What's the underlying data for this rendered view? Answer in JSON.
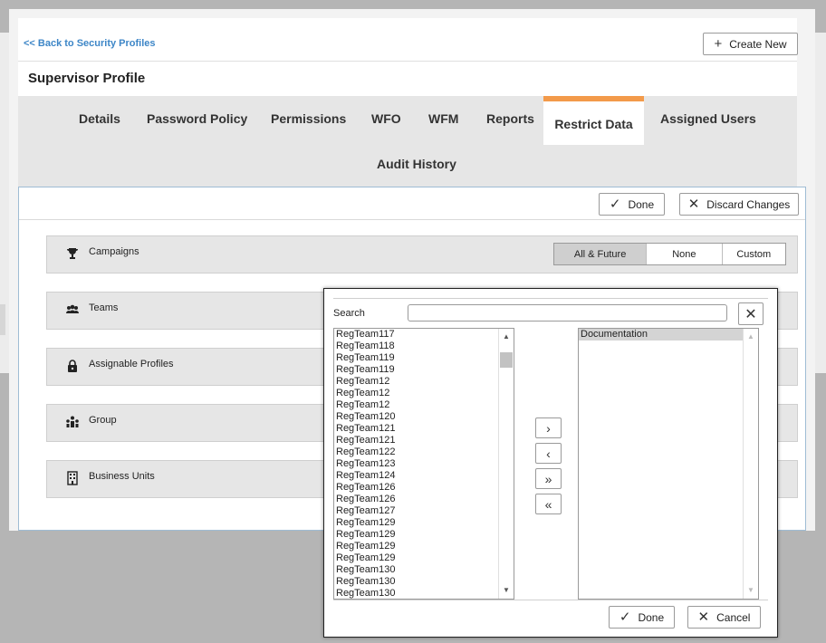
{
  "nav": {
    "back_label": "<< Back to Security Profiles",
    "create_label": "Create New"
  },
  "profile": {
    "title": "Supervisor Profile"
  },
  "tabs": [
    {
      "label": "Details"
    },
    {
      "label": "Password Policy"
    },
    {
      "label": "Permissions"
    },
    {
      "label": "WFO"
    },
    {
      "label": "WFM"
    },
    {
      "label": "Reports"
    },
    {
      "label": "Restrict Data",
      "active": true
    },
    {
      "label": "Assigned Users"
    },
    {
      "label": "Audit History"
    }
  ],
  "toolbar": {
    "done_label": "Done",
    "discard_label": "Discard Changes"
  },
  "sections": [
    {
      "label": "Campaigns",
      "icon": "trophy-icon"
    },
    {
      "label": "Teams",
      "icon": "users-icon"
    },
    {
      "label": "Assignable Profiles",
      "icon": "lock-icon"
    },
    {
      "label": "Group",
      "icon": "group-icon"
    },
    {
      "label": "Business Units",
      "icon": "building-icon"
    }
  ],
  "campaigns_filter": {
    "options": [
      "All & Future",
      "None",
      "Custom"
    ],
    "selected": "All & Future"
  },
  "modal": {
    "search_label": "Search",
    "search_value": "",
    "available": [
      "RegTeam117",
      "RegTeam118",
      "RegTeam119",
      "RegTeam119",
      "RegTeam12",
      "RegTeam12",
      "RegTeam12",
      "RegTeam120",
      "RegTeam121",
      "RegTeam121",
      "RegTeam122",
      "RegTeam123",
      "RegTeam124",
      "RegTeam126",
      "RegTeam126",
      "RegTeam127",
      "RegTeam129",
      "RegTeam129",
      "RegTeam129",
      "RegTeam129",
      "RegTeam130",
      "RegTeam130",
      "RegTeam130"
    ],
    "selected_items": [
      "Documentation"
    ],
    "move_buttons": [
      {
        "name": "move-right-button",
        "glyph": "›"
      },
      {
        "name": "move-left-button",
        "glyph": "‹"
      },
      {
        "name": "move-all-right-button",
        "glyph": "»"
      },
      {
        "name": "move-all-left-button",
        "glyph": "«"
      }
    ],
    "done_label": "Done",
    "cancel_label": "Cancel"
  }
}
